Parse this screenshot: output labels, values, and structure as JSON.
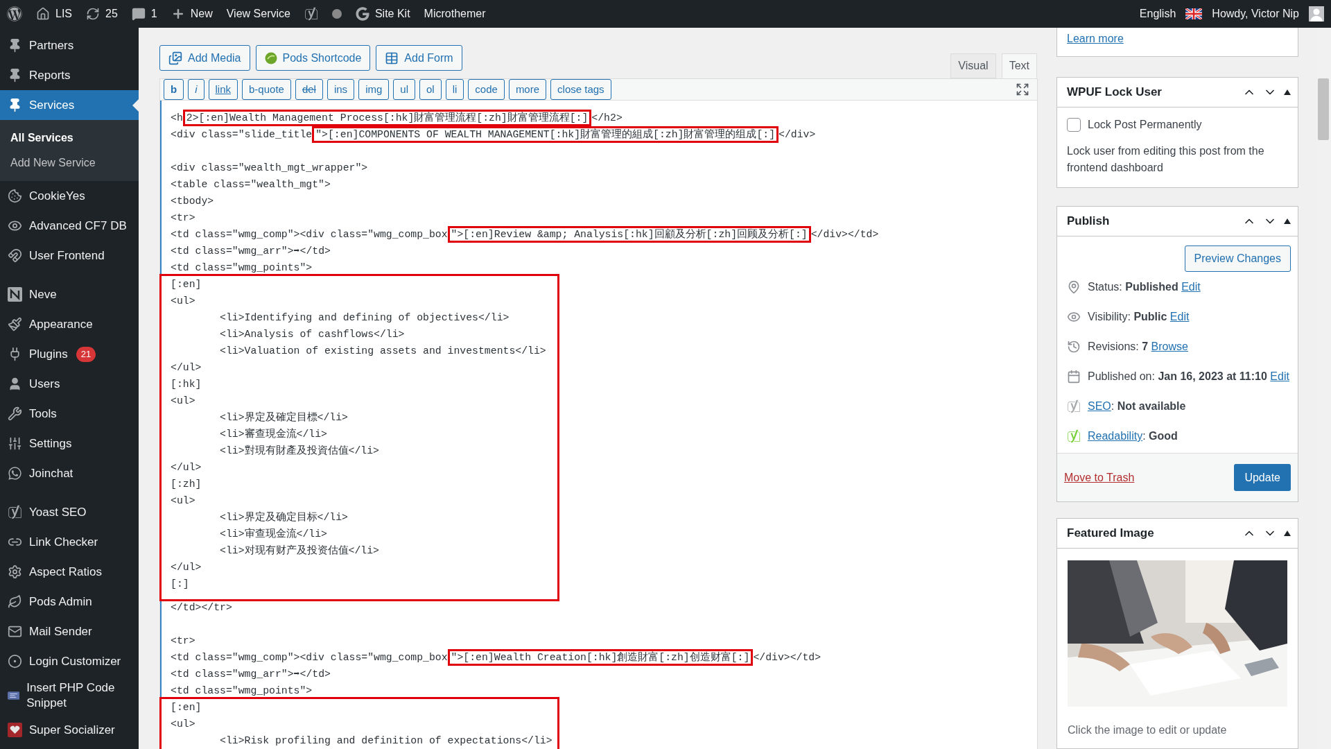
{
  "admin_bar": {
    "items": [
      {
        "kind": "logo"
      },
      {
        "kind": "site",
        "label": "LIS"
      },
      {
        "kind": "updates",
        "label": "25"
      },
      {
        "kind": "comments",
        "label": "1"
      },
      {
        "kind": "new",
        "label": "New"
      },
      {
        "kind": "text",
        "label": "View Service"
      },
      {
        "kind": "seo"
      },
      {
        "kind": "status_dot"
      },
      {
        "kind": "sitekit",
        "label": "Site Kit"
      },
      {
        "kind": "text",
        "label": "Microthemer"
      }
    ],
    "language": "English",
    "greeting": "Howdy, Victor Nip"
  },
  "sidebar": {
    "items": [
      {
        "kind": "pin",
        "label": "Partners",
        "selected": false
      },
      {
        "kind": "pin",
        "label": "Reports",
        "selected": false
      },
      {
        "kind": "pin",
        "label": "Services",
        "selected": true,
        "children": [
          {
            "label": "All Services",
            "selected": true
          },
          {
            "label": "Add New Service",
            "selected": false
          }
        ]
      },
      {
        "kind": "cookie",
        "label": "CookieYes",
        "selected": false
      },
      {
        "kind": "eye",
        "label": "Advanced CF7 DB",
        "selected": false
      },
      {
        "kind": "frontend",
        "label": "User Frontend",
        "selected": false
      },
      {
        "kind": "separator"
      },
      {
        "kind": "neve",
        "label": "Neve",
        "selected": false
      },
      {
        "kind": "appearance",
        "label": "Appearance",
        "selected": false
      },
      {
        "kind": "plugins",
        "label": "Plugins",
        "selected": false,
        "badge": "21"
      },
      {
        "kind": "users",
        "label": "Users",
        "selected": false
      },
      {
        "kind": "tools",
        "label": "Tools",
        "selected": false
      },
      {
        "kind": "settings",
        "label": "Settings",
        "selected": false
      },
      {
        "kind": "chat",
        "label": "Joinchat",
        "selected": false
      },
      {
        "kind": "separator"
      },
      {
        "kind": "yoast",
        "label": "Yoast SEO",
        "selected": false
      },
      {
        "kind": "link",
        "label": "Link Checker",
        "selected": false
      },
      {
        "kind": "gear",
        "label": "Aspect Ratios",
        "selected": false
      },
      {
        "kind": "pods",
        "label": "Pods Admin",
        "selected": false
      },
      {
        "kind": "mail",
        "label": "Mail Sender",
        "selected": false
      },
      {
        "kind": "login",
        "label": "Login Customizer",
        "selected": false
      },
      {
        "kind": "php",
        "label": "Insert PHP Code Snippet",
        "selected": false
      },
      {
        "kind": "social",
        "label": "Super Socializer",
        "selected": false
      }
    ]
  },
  "editor": {
    "media_buttons": [
      {
        "kind": "media",
        "label": "Add Media"
      },
      {
        "kind": "pods",
        "label": "Pods Shortcode"
      },
      {
        "kind": "form",
        "label": "Add Form"
      }
    ],
    "tabs": [
      {
        "label": "Visual",
        "selected": false
      },
      {
        "label": "Text",
        "selected": true
      }
    ],
    "quicktags": [
      {
        "kind": "bold",
        "label": "b"
      },
      {
        "kind": "italic",
        "label": "i"
      },
      {
        "kind": "underline",
        "label": "link"
      },
      {
        "kind": "plain",
        "label": "b-quote"
      },
      {
        "kind": "strike",
        "label": "del"
      },
      {
        "kind": "plain",
        "label": "ins"
      },
      {
        "kind": "plain",
        "label": "img"
      },
      {
        "kind": "plain",
        "label": "ul"
      },
      {
        "kind": "plain",
        "label": "ol"
      },
      {
        "kind": "plain",
        "label": "li"
      },
      {
        "kind": "plain",
        "label": "code"
      },
      {
        "kind": "plain",
        "label": "more"
      },
      {
        "kind": "plain",
        "label": "close tags"
      }
    ],
    "code": [
      {
        "kind": "marked",
        "before": "<h",
        "marked": "2>[:en]Wealth Management Process[:hk]財富管理流程[:zh]財富管理流程[:]",
        "after": "</h2>"
      },
      {
        "kind": "marked",
        "before": "<div class=\"slide_title",
        "marked": "\">[:en]COMPONENTS OF WEALTH MANAGEMENT[:hk]財富管理的組成[:zh]財富管理的组成[:]",
        "after": "</div>"
      },
      {
        "kind": "blank"
      },
      {
        "kind": "line",
        "text": "<div class=\"wealth_mgt_wrapper\">"
      },
      {
        "kind": "line",
        "text": "<table class=\"wealth_mgt\">"
      },
      {
        "kind": "line",
        "text": "<tbody>"
      },
      {
        "kind": "line",
        "text": "<tr>"
      },
      {
        "kind": "marked",
        "before": "<td class=\"wmg_comp\"><div class=\"wmg_comp_box",
        "marked": "\">[:en]Review &amp; Analysis[:hk]回顧及分析[:zh]回顾及分析[:]",
        "after": "</div></td>"
      },
      {
        "kind": "line",
        "text": "<td class=\"wmg_arr\">➡</td>"
      },
      {
        "kind": "line",
        "text": "<td class=\"wmg_points\">"
      },
      {
        "kind": "block",
        "lines": [
          "[:en]",
          "<ul>",
          "\t<li>Identifying and defining of objectives</li>",
          "\t<li>Analysis of cashflows</li>",
          "\t<li>Valuation of existing assets and investments</li>",
          "</ul>",
          "[:hk]",
          "<ul>",
          "\t<li>界定及確定目標</li>",
          "\t<li>審查現金流</li>",
          "\t<li>對現有財產及投資估值</li>",
          "</ul>",
          "[:zh]",
          "<ul>",
          "\t<li>界定及确定目标</li>",
          "\t<li>审查现金流</li>",
          "\t<li>对现有财产及投资估值</li>",
          "</ul>",
          "[:]"
        ]
      },
      {
        "kind": "line",
        "text": "</td></tr>"
      },
      {
        "kind": "blank"
      },
      {
        "kind": "line",
        "text": "<tr>"
      },
      {
        "kind": "marked",
        "before": "<td class=\"wmg_comp\"><div class=\"wmg_comp_box",
        "marked": "\">[:en]Wealth Creation[:hk]創造財富[:zh]创造财富[:]",
        "after": "</div></td>"
      },
      {
        "kind": "line",
        "text": "<td class=\"wmg_arr\">➡</td>"
      },
      {
        "kind": "line",
        "text": "<td class=\"wmg_points\">"
      },
      {
        "kind": "block",
        "lines": [
          "[:en]",
          "<ul>",
          "\t<li>Risk profiling and definition of expectations</li>"
        ]
      }
    ]
  },
  "notice_box": {
    "link": "Learn more"
  },
  "lock_user": {
    "title": "WPUF Lock User",
    "checkbox": {
      "label": "Lock Post Permanently",
      "checked": false
    },
    "description": "Lock user from editing this post from the frontend dashboard"
  },
  "publish": {
    "title": "Publish",
    "preview_button": "Preview Changes",
    "rows": [
      {
        "kind": "status",
        "before": "Status: **Published**",
        "link": "Edit"
      },
      {
        "kind": "visibility",
        "before": "Visibility: **Public**",
        "link": "Edit"
      },
      {
        "kind": "revisions",
        "before": "Revisions: **7**",
        "link": "Browse"
      },
      {
        "kind": "date",
        "before": "Published on: **Jan 16, 2023 at 11:10**",
        "link": "Edit"
      },
      {
        "kind": "seo",
        "link": "SEO",
        "after": ": **Not available**",
        "color": "#a7aaad"
      },
      {
        "kind": "readability",
        "link": "Readability",
        "after": ": **Good**",
        "color": "#7ad03a"
      }
    ],
    "trash_link": "Move to Trash",
    "update_button": "Update"
  },
  "featured_image": {
    "title": "Featured Image",
    "caption": "Click the image to edit or update"
  }
}
